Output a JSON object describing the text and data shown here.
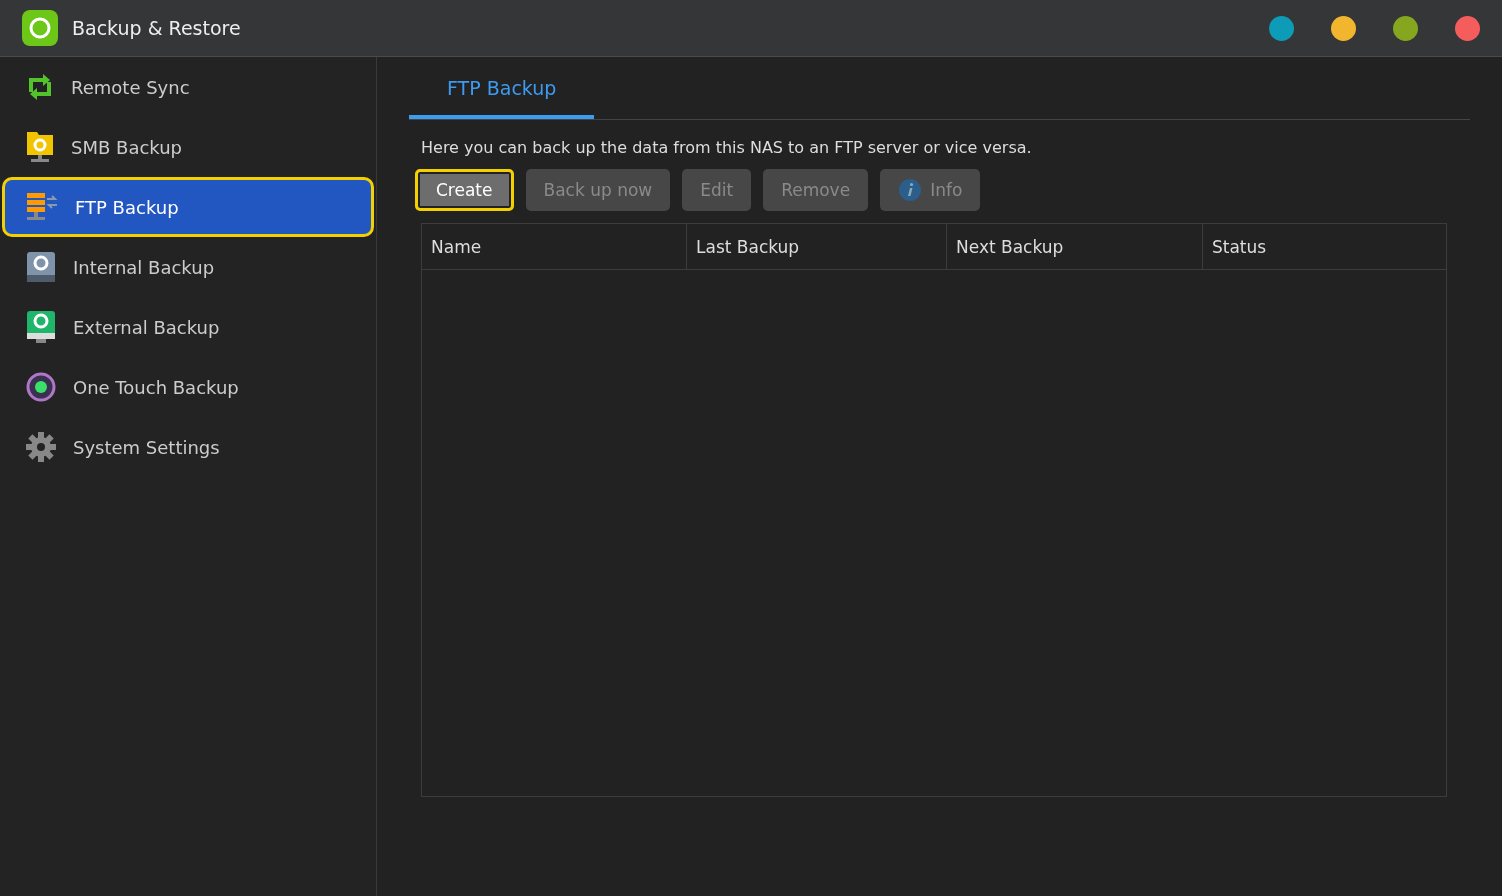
{
  "window": {
    "title": "Backup & Restore",
    "controls": [
      {
        "color": "#0e9bb8"
      },
      {
        "color": "#f2b62e"
      },
      {
        "color": "#86a61f"
      },
      {
        "color": "#f55c5c"
      }
    ]
  },
  "sidebar": {
    "items": [
      {
        "label": "Remote Sync",
        "kind": "sync",
        "selected": false
      },
      {
        "label": "SMB Backup",
        "kind": "smb",
        "selected": false
      },
      {
        "label": "FTP Backup",
        "kind": "ftp",
        "selected": true
      },
      {
        "label": "Internal Backup",
        "kind": "internal",
        "selected": false
      },
      {
        "label": "External Backup",
        "kind": "external",
        "selected": false
      },
      {
        "label": "One Touch Backup",
        "kind": "onetouch",
        "selected": false
      },
      {
        "label": "System Settings",
        "kind": "settings",
        "selected": false
      }
    ]
  },
  "tabs": [
    {
      "label": "FTP Backup",
      "selected": true
    }
  ],
  "description": "Here you can back up the data from this NAS to an FTP server or vice versa.",
  "toolbar": [
    {
      "label": "Create",
      "disabled": false,
      "focused": true
    },
    {
      "label": "Back up now",
      "disabled": true,
      "focused": false
    },
    {
      "label": "Edit",
      "disabled": true,
      "focused": false
    },
    {
      "label": "Remove",
      "disabled": true,
      "focused": false
    },
    {
      "label": "Info",
      "kind": "info",
      "disabled": true,
      "focused": false
    }
  ],
  "table": {
    "columns": [
      "Name",
      "Last Backup",
      "Next Backup",
      "Status"
    ]
  }
}
